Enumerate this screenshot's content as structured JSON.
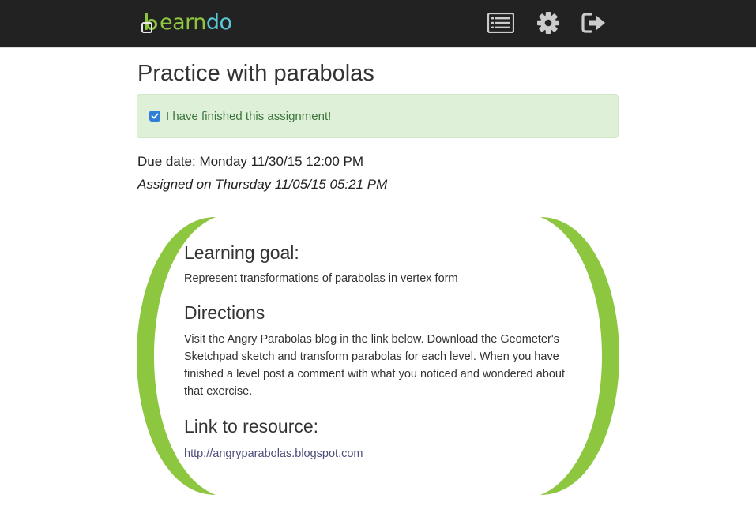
{
  "header": {
    "logo_text_part1": "earn",
    "logo_text_part2": "do",
    "icons": [
      "list-icon",
      "gear-icon",
      "sign-out-icon"
    ],
    "colors": {
      "background": "#222222",
      "logo_green": "#8dc63f",
      "logo_blue": "#5bc8d8",
      "icon": "#cccccc"
    }
  },
  "assignment": {
    "title": "Practice with parabolas",
    "finished_label": "I have finished this assignment!",
    "finished": true,
    "due_date": "Due date: Monday 11/30/15 12:00 PM",
    "assigned_on": "Assigned on Thursday 11/05/15 05:21 PM"
  },
  "card": {
    "goal_heading": "Learning goal:",
    "goal_text": "Represent transformations of parabolas in vertex form",
    "directions_heading": "Directions",
    "directions_text": "Visit the Angry Parabolas blog in the link below. Download the Geometer's Sketchpad sketch and transform parabolas for each level. When you have finished a level post a comment with what you noticed and wondered about that exercise.",
    "resource_heading": "Link to resource:",
    "resource_link": "http://angryparabolas.blogspot.com",
    "accent_color": "#8dc63f"
  }
}
